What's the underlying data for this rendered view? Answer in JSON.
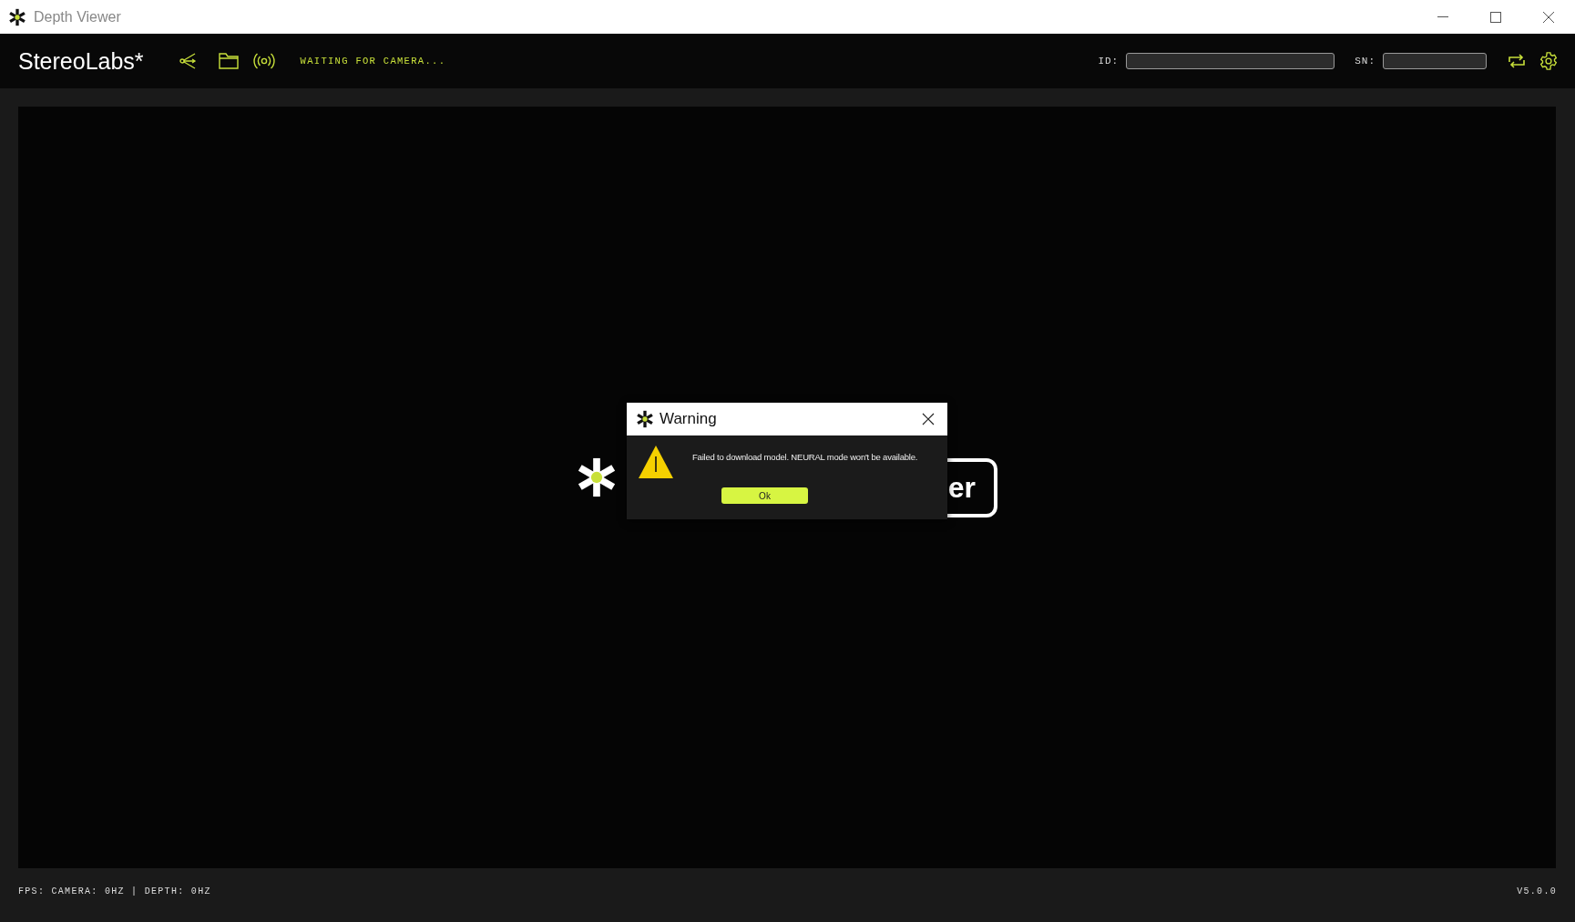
{
  "window": {
    "title": "Depth Viewer"
  },
  "toolbar": {
    "brand": "StereoLabs*",
    "status": "WAITING FOR CAMERA...",
    "id_field": {
      "label": "ID:"
    },
    "sn_field": {
      "label": "SN:"
    }
  },
  "viewer": {
    "logo_text": "er"
  },
  "dialog": {
    "title": "Warning",
    "message": "Failed to download model. NEURAL mode won't be available.",
    "button": "Ok"
  },
  "status_bar": {
    "fps": "FPS: CAMERA: 0HZ | DEPTH: 0HZ",
    "version": "V5.0.0"
  }
}
